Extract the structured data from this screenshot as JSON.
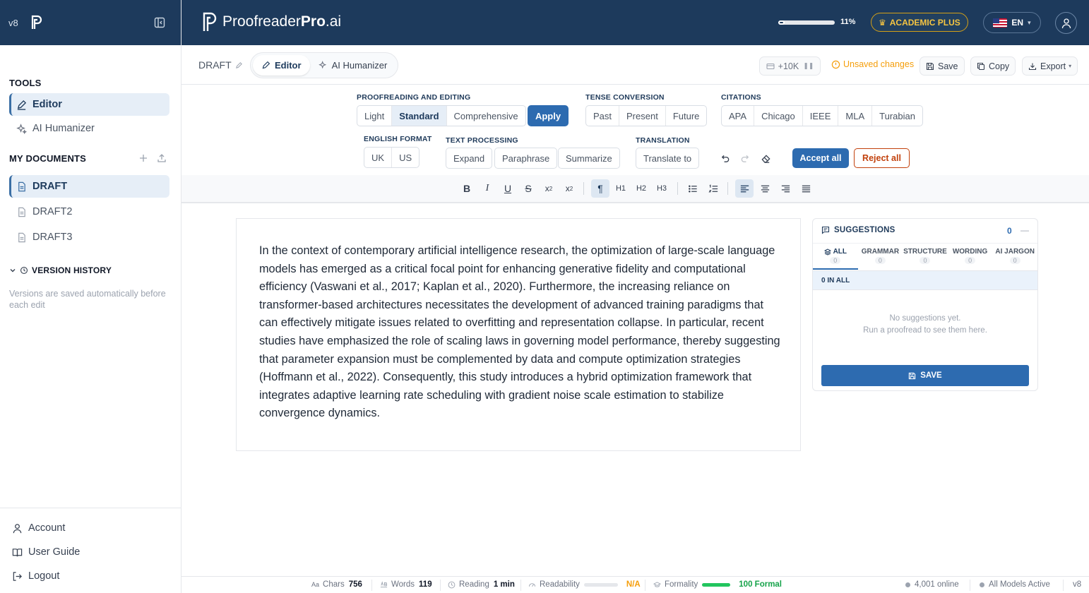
{
  "sidebar": {
    "version": "v8",
    "tools_heading": "TOOLS",
    "tools": [
      {
        "label": "Editor",
        "icon": "pencil-icon",
        "active": true
      },
      {
        "label": "AI Humanizer",
        "icon": "sparkle-icon",
        "active": false
      }
    ],
    "docs_heading": "MY DOCUMENTS",
    "documents": [
      {
        "label": "DRAFT",
        "active": true
      },
      {
        "label": "DRAFT2",
        "active": false
      },
      {
        "label": "DRAFT3",
        "active": false
      }
    ],
    "version_history_label": "VERSION HISTORY",
    "version_history_note": "Versions are saved automatically before each edit",
    "bottom_links": [
      {
        "label": "Account",
        "icon": "user-icon"
      },
      {
        "label": "User Guide",
        "icon": "book-icon"
      },
      {
        "label": "Logout",
        "icon": "logout-icon"
      }
    ]
  },
  "header": {
    "brand_regular": "Proofreader",
    "brand_bold": "Pro",
    "brand_suffix": ".ai",
    "usage_percent_label": "11%",
    "usage_fraction": 0.11,
    "plan_label": "ACADEMIC PLUS",
    "language": "EN"
  },
  "docbar": {
    "doc_title": "DRAFT",
    "tabs": [
      {
        "label": "Editor",
        "active": true
      },
      {
        "label": "AI Humanizer",
        "active": false
      }
    ],
    "credit_label": "+10K",
    "unsaved_label": "Unsaved changes",
    "save_label": "Save",
    "copy_label": "Copy",
    "export_label": "Export"
  },
  "toolbar": {
    "proofreading": {
      "label": "PROOFREADING AND EDITING",
      "options": [
        "Light",
        "Standard",
        "Comprehensive"
      ],
      "selected": "Standard",
      "apply_label": "Apply"
    },
    "tense": {
      "label": "TENSE CONVERSION",
      "options": [
        "Past",
        "Present",
        "Future"
      ]
    },
    "citations": {
      "label": "CITATIONS",
      "options": [
        "APA",
        "Chicago",
        "IEEE",
        "MLA",
        "Turabian"
      ]
    },
    "english_format": {
      "label": "ENGLISH FORMAT",
      "options": [
        "UK",
        "US"
      ]
    },
    "text_processing": {
      "label": "TEXT PROCESSING",
      "options": [
        "Expand",
        "Paraphrase",
        "Summarize"
      ]
    },
    "translation": {
      "label": "TRANSLATION",
      "button": "Translate to"
    },
    "accept_all_label": "Accept all",
    "reject_all_label": "Reject all"
  },
  "format_bar": {
    "h1": "H1",
    "h2": "H2",
    "h3": "H3"
  },
  "editor": {
    "text": "In the context of contemporary artificial intelligence research, the optimization of large-scale language models has emerged as a critical focal point for enhancing generative fidelity and computational efficiency (Vaswani et al., 2017; Kaplan et al., 2020). Furthermore, the increasing reliance on transformer-based architectures necessitates the development of advanced training paradigms that can effectively mitigate issues related to overfitting and representation collapse. In particular, recent studies have emphasized the role of scaling laws in governing model performance, thereby suggesting that parameter expansion must be complemented by data and compute optimization strategies (Hoffmann et al., 2022). Consequently, this study introduces a hybrid optimization framework that integrates adaptive learning rate scheduling with gradient noise scale estimation to stabilize convergence dynamics."
  },
  "suggestions": {
    "title": "SUGGESTIONS",
    "count": "0",
    "tabs": [
      {
        "label": "ALL",
        "count": "0",
        "active": true
      },
      {
        "label": "GRAMMAR",
        "count": "0",
        "active": false
      },
      {
        "label": "STRUCTURE",
        "count": "0",
        "active": false
      },
      {
        "label": "WORDING",
        "count": "0",
        "active": false
      },
      {
        "label": "AI JARGON",
        "count": "0",
        "active": false
      }
    ],
    "in_all_label": "0 IN ALL",
    "empty_line1": "No suggestions yet.",
    "empty_line2": "Run a proofread to see them here.",
    "save_label": "SAVE"
  },
  "footer": {
    "chars_label": "Chars",
    "chars_value": "756",
    "words_label": "Words",
    "words_value": "119",
    "reading_label": "Reading",
    "reading_value": "1 min",
    "readability_label": "Readability",
    "readability_value": "N/A",
    "formality_label": "Formality",
    "formality_value": "100 Formal",
    "online_label": "4,001 online",
    "models_label": "All Models Active",
    "version": "v8"
  },
  "colors": {
    "header_bg": "#1d3a5c",
    "accent": "#2d6bb0",
    "warning": "#f59e0b",
    "reject": "#c2410c",
    "success": "#22c55e"
  }
}
